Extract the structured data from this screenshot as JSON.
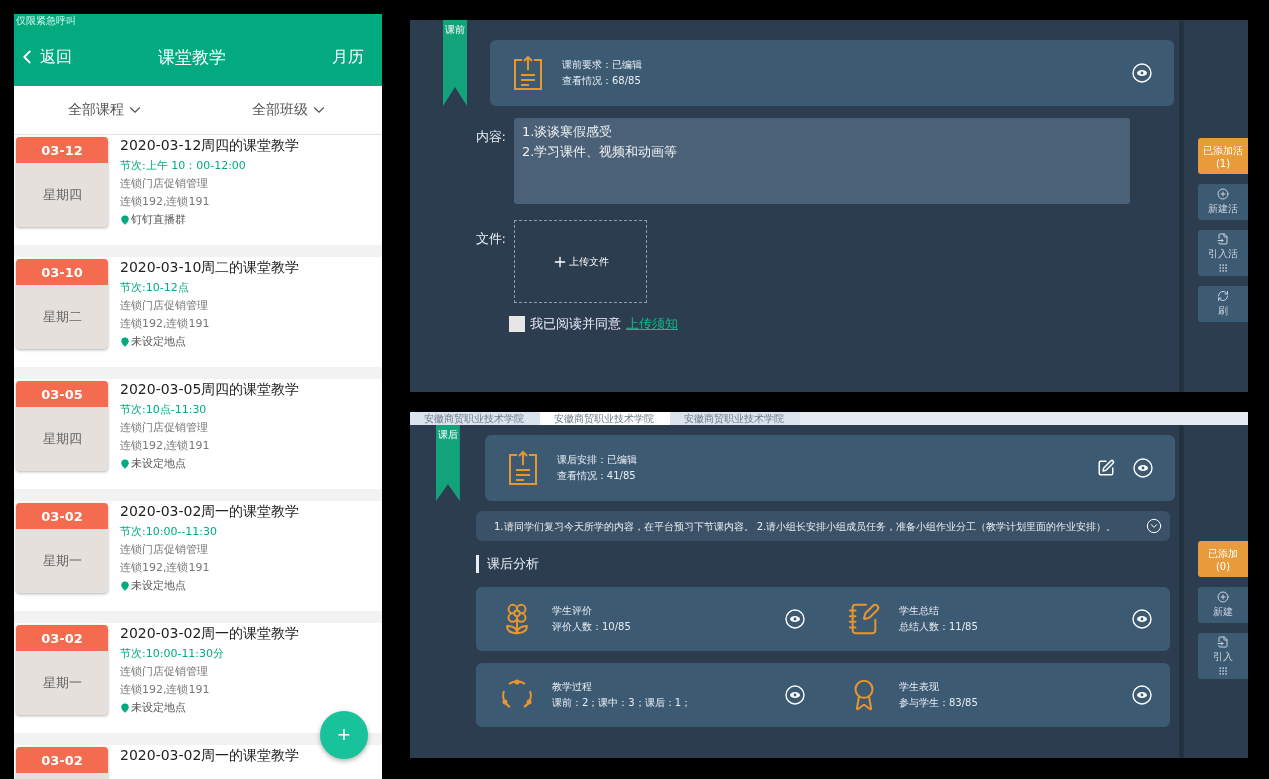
{
  "phone": {
    "status_text": "仅限紧急呼叫",
    "back": "返回",
    "title": "课堂教学",
    "right_action": "月历",
    "filters": [
      {
        "label": "全部课程"
      },
      {
        "label": "全部班级"
      }
    ],
    "lessons": [
      {
        "date": "03-12",
        "weekday": "星期四",
        "title": "2020-03-12周四的课堂教学",
        "period": "节次:上午 10：00-12:00",
        "course": "连锁门店促销管理",
        "classes": "连锁192,连锁191",
        "location": "钉钉直播群"
      },
      {
        "date": "03-10",
        "weekday": "星期二",
        "title": "2020-03-10周二的课堂教学",
        "period": "节次:10-12点",
        "course": "连锁门店促销管理",
        "classes": "连锁192,连锁191",
        "location": "未设定地点"
      },
      {
        "date": "03-05",
        "weekday": "星期四",
        "title": "2020-03-05周四的课堂教学",
        "period": "节次:10点-11:30",
        "course": "连锁门店促销管理",
        "classes": "连锁192,连锁191",
        "location": "未设定地点"
      },
      {
        "date": "03-02",
        "weekday": "星期一",
        "title": "2020-03-02周一的课堂教学",
        "period": "节次:10:00--11:30",
        "course": "连锁门店促销管理",
        "classes": "连锁192,连锁191",
        "location": "未设定地点"
      },
      {
        "date": "03-02",
        "weekday": "星期一",
        "title": "2020-03-02周一的课堂教学",
        "period": "节次:10:00-11:30分",
        "course": "连锁门店促销管理",
        "classes": "连锁192,连锁191",
        "location": "未设定地点"
      },
      {
        "date": "03-02",
        "title": "2020-03-02周一的课堂教学"
      }
    ],
    "fab": "+"
  },
  "before_class": {
    "stage": "课前",
    "summary": [
      "课前要求：已编辑",
      "查看情况：68/85"
    ],
    "content_label": "内容:",
    "content": "1.谈谈寒假感受\n2.学习课件、视频和动画等",
    "file_label": "文件:",
    "upload": "上传文件",
    "agree_checked": false,
    "agree_text": "我已阅读并同意",
    "agree_link": "上传须知",
    "rail": {
      "added": [
        "已添加活",
        "(1)"
      ],
      "actions": [
        {
          "kind": "new",
          "label": "新建活"
        },
        {
          "kind": "import",
          "label": "引入活"
        },
        {
          "kind": "refresh",
          "label": "刷"
        }
      ]
    }
  },
  "after_class": {
    "browser_tabs": [
      {
        "label": "安徽商贸职业技术学院",
        "selected": false
      },
      {
        "label": "安徽商贸职业技术学院",
        "selected": true
      },
      {
        "label": "安徽商贸职业技术学院",
        "selected": false
      }
    ],
    "stage": "课后",
    "summary": [
      "课后安排：已编辑",
      "查看情况：41/85"
    ],
    "notice": "1.请同学们复习今天所学的内容，在平台预习下节课内容。 2.请小组长安排小组成员任务，准备小组作业分工（教学计划里面的作业安排）。",
    "notice_expanded": false,
    "section": "课后分析",
    "analysis": [
      {
        "kind": "flower",
        "title": "学生评价",
        "detail": "评价人数：10/85"
      },
      {
        "kind": "notebook",
        "title": "学生总结",
        "detail": "总结人数：11/85"
      },
      {
        "kind": "cycle",
        "title": "教学过程",
        "detail": "课前：2；课中：3；课后：1；"
      },
      {
        "kind": "medal",
        "title": "学生表现",
        "detail": "参与学生：83/85"
      }
    ],
    "rail": {
      "added": [
        "已添加",
        "(0)"
      ],
      "actions": [
        {
          "kind": "new",
          "label": "新建"
        },
        {
          "kind": "import",
          "label": "引入"
        }
      ]
    }
  }
}
